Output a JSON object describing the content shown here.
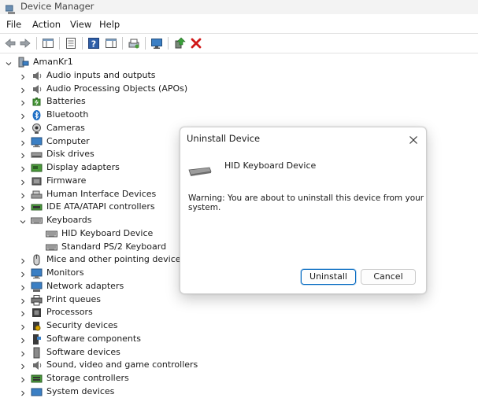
{
  "window": {
    "title": "Device Manager"
  },
  "menu": [
    "File",
    "Action",
    "View",
    "Help"
  ],
  "toolbar": {
    "buttons": [
      "back-arrow-icon",
      "forward-arrow-icon",
      "show-hide-console-tree-icon",
      "properties-icon",
      "help-icon",
      "action-pane-icon",
      "scan-hardware-changes-icon",
      "monitor-icon",
      "update-driver-icon",
      "uninstall-device-icon"
    ]
  },
  "tree": {
    "root": "AmanKr1",
    "categories": [
      {
        "label": "Audio inputs and outputs",
        "icon": "speaker-icon"
      },
      {
        "label": "Audio Processing Objects (APOs)",
        "icon": "speaker-icon"
      },
      {
        "label": "Batteries",
        "icon": "battery-icon"
      },
      {
        "label": "Bluetooth",
        "icon": "bluetooth-icon"
      },
      {
        "label": "Cameras",
        "icon": "camera-icon"
      },
      {
        "label": "Computer",
        "icon": "computer-icon"
      },
      {
        "label": "Disk drives",
        "icon": "disk-drive-icon"
      },
      {
        "label": "Display adapters",
        "icon": "display-adapter-icon"
      },
      {
        "label": "Firmware",
        "icon": "firmware-icon"
      },
      {
        "label": "Human Interface Devices",
        "icon": "hid-icon"
      },
      {
        "label": "IDE ATA/ATAPI controllers",
        "icon": "ide-controller-icon"
      },
      {
        "label": "Keyboards",
        "icon": "keyboard-icon",
        "expanded": true,
        "children": [
          "HID Keyboard Device",
          "Standard PS/2 Keyboard"
        ]
      },
      {
        "label": "Mice and other pointing devices",
        "icon": "mouse-icon"
      },
      {
        "label": "Monitors",
        "icon": "monitor-icon"
      },
      {
        "label": "Network adapters",
        "icon": "network-adapter-icon"
      },
      {
        "label": "Print queues",
        "icon": "printer-icon"
      },
      {
        "label": "Processors",
        "icon": "processor-icon"
      },
      {
        "label": "Security devices",
        "icon": "security-device-icon"
      },
      {
        "label": "Software components",
        "icon": "software-component-icon"
      },
      {
        "label": "Software devices",
        "icon": "software-device-icon"
      },
      {
        "label": "Sound, video and game controllers",
        "icon": "speaker-icon"
      },
      {
        "label": "Storage controllers",
        "icon": "storage-controller-icon"
      },
      {
        "label": "System devices",
        "icon": "system-device-icon"
      }
    ]
  },
  "dialog": {
    "title": "Uninstall Device",
    "device_name": "HID Keyboard Device",
    "warning": "Warning: You are about to uninstall this device from your system.",
    "uninstall_label": "Uninstall",
    "cancel_label": "Cancel"
  },
  "colors": {
    "accent": "#0067c0",
    "uninstall_red": "#d01818"
  }
}
